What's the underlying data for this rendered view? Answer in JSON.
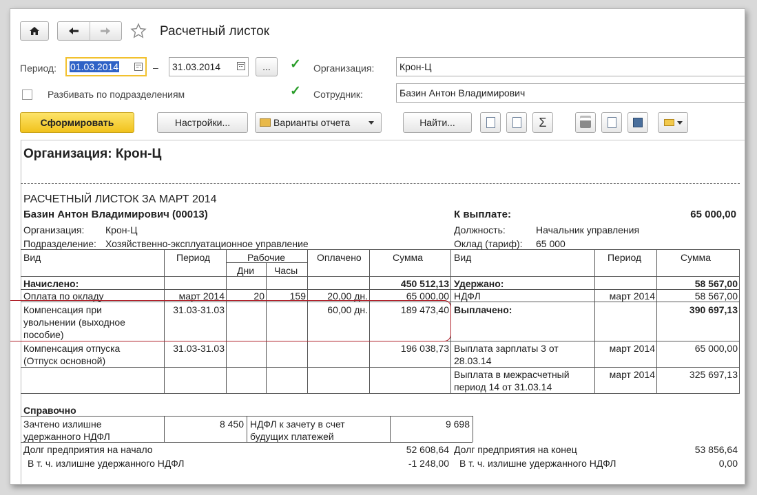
{
  "window": {
    "title": "Расчетный листок"
  },
  "toolbar": {
    "home_icon": "home-icon",
    "back_icon": "arrow-left-icon",
    "forward_icon": "arrow-right-icon",
    "favorite_icon": "star-icon"
  },
  "filters": {
    "period_label": "Период:",
    "period_start": "01.03.2014",
    "period_dash": "–",
    "period_end": "31.03.2014",
    "period_more": "...",
    "organization_label": "Организация:",
    "organization_value": "Крон-Ц",
    "organization_checked": true,
    "split_label": "Разбивать по подразделениям",
    "split_checked": false,
    "employee_label": "Сотрудник:",
    "employee_value": "Базин Антон Владимирович",
    "employee_checked": true
  },
  "actions": {
    "generate": "Сформировать",
    "settings": "Настройки...",
    "variants": "Варианты отчета",
    "find": "Найти...",
    "sum_symbol": "Σ"
  },
  "colors": {
    "accent_yellow": "#f7cf2f",
    "selection": "#2f62c6",
    "highlight_border": "#b0202a",
    "check_green": "#2a9d2a"
  },
  "report": {
    "org_header": "Организация: Крон-Ц",
    "title": "РАСЧЕТНЫЙ ЛИСТОК ЗА МАРТ 2014",
    "employee_name": "Базин Антон Владимирович (00013)",
    "to_pay_label": "К выплате:",
    "to_pay_value": "65 000,00",
    "org_label": "Организация:",
    "org_value": "Крон-Ц",
    "dept_label": "Подразделение:",
    "dept_value": "Хозяйственно-эксплуатационное управление",
    "position_label": "Должность:",
    "position_value": "Начальник управления",
    "salary_label": "Оклад (тариф):",
    "salary_value": "65 000",
    "left_headers": {
      "vid": "Вид",
      "period": "Период",
      "working": "Рабочие",
      "days": "Дни",
      "hours": "Часы",
      "paid": "Оплачено",
      "sum": "Сумма"
    },
    "right_headers": {
      "vid": "Вид",
      "period": "Период",
      "sum": "Сумма"
    },
    "accrued_label": "Начислено:",
    "accrued_total": "450 512,13",
    "accruals": [
      {
        "vid": "Оплата по окладу",
        "period": "март 2014",
        "days": "20",
        "hours": "159",
        "paid": "20,00 дн.",
        "sum": "65 000,00"
      },
      {
        "vid_lines": [
          "Компенсация при",
          "увольнении (выходное",
          "пособие)"
        ],
        "period": "31.03-31.03",
        "days": "",
        "hours": "",
        "paid": "60,00 дн.",
        "sum": "189 473,40"
      },
      {
        "vid_lines": [
          "Компенсация отпуска",
          "(Отпуск основной)"
        ],
        "period": "31.03-31.03",
        "days": "",
        "hours": "",
        "paid": "",
        "sum": "196 038,73"
      }
    ],
    "withheld_label": "Удержано:",
    "withheld_total": "58 567,00",
    "withholdings": [
      {
        "vid": "НДФЛ",
        "period": "март 2014",
        "sum": "58 567,00"
      }
    ],
    "paid_label": "Выплачено:",
    "paid_total": "390 697,13",
    "payments": [
      {
        "vid_lines": [
          "Выплата зарплаты 3 от",
          "28.03.14"
        ],
        "period": "март 2014",
        "sum": "65 000,00"
      },
      {
        "vid_lines": [
          "Выплата в межрасчетный",
          "период 14 от 31.03.14"
        ],
        "period": "март 2014",
        "sum": "325 697,13"
      }
    ],
    "reference_label": "Справочно",
    "reference": {
      "excess_lines": [
        "Зачтено излишне",
        "удержанного НДФЛ"
      ],
      "excess_value": "8 450",
      "future_lines": [
        "НДФЛ к зачету в счет",
        "будущих платежей"
      ],
      "future_value": "9 698"
    },
    "debt_start_label": "Долг предприятия на начало",
    "debt_start_value": "52 608,64",
    "debt_start_ndfl_label": "В т. ч. излишне удержанного НДФЛ",
    "debt_start_ndfl_value": "-1 248,00",
    "debt_end_label": "Долг предприятия на конец",
    "debt_end_value": "53 856,64",
    "debt_end_ndfl_label": "В т. ч. излишне удержанного НДФЛ",
    "debt_end_ndfl_value": "0,00"
  }
}
